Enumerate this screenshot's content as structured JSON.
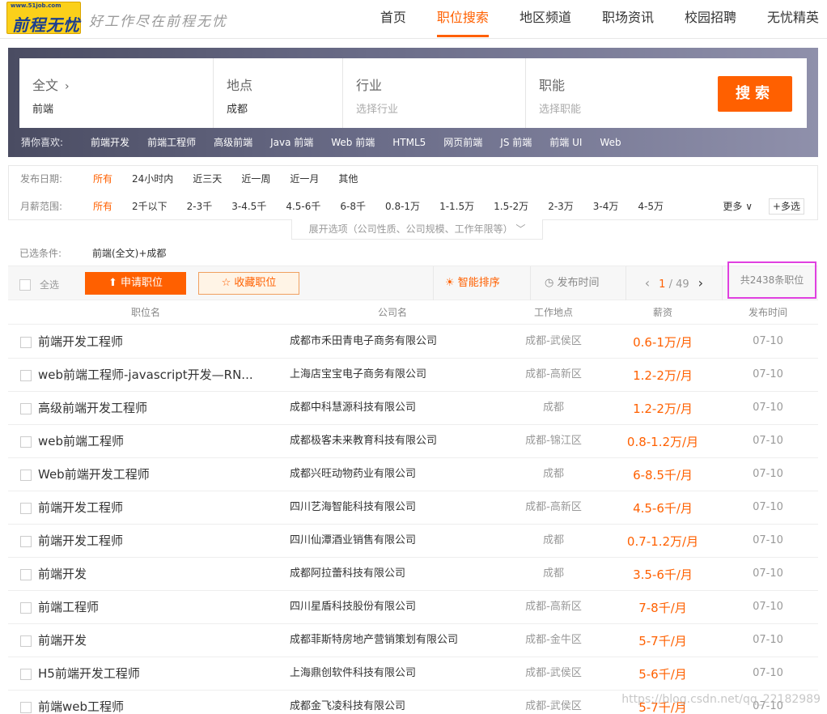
{
  "header": {
    "logo_url": "www.51job.com",
    "logo_text": "前程无忧",
    "slogan": "好工作尽在前程无忧",
    "nav": [
      "首页",
      "职位搜索",
      "地区频道",
      "职场资讯",
      "校园招聘",
      "无忧精英"
    ],
    "active_nav": "职位搜索"
  },
  "search": {
    "fulltext_label": "全文",
    "fulltext_value": "前端",
    "location_label": "地点",
    "location_value": "成都",
    "industry_label": "行业",
    "industry_placeholder": "选择行业",
    "function_label": "职能",
    "function_placeholder": "选择职能",
    "button": "搜索",
    "guess_label": "猜你喜欢:",
    "guess_items": [
      "前端开发",
      "前端工程师",
      "高级前端",
      "Java 前端",
      "Web 前端",
      "HTML5",
      "网页前端",
      "JS 前端",
      "前端 UI",
      "Web"
    ]
  },
  "filters": {
    "date_label": "发布日期:",
    "date_options": [
      "所有",
      "24小时内",
      "近三天",
      "近一周",
      "近一月",
      "其他"
    ],
    "salary_label": "月薪范围:",
    "salary_options": [
      "所有",
      "2千以下",
      "2-3千",
      "3-4.5千",
      "4.5-6千",
      "6-8千",
      "0.8-1万",
      "1-1.5万",
      "1.5-2万",
      "2-3万",
      "3-4万",
      "4-5万"
    ],
    "more": "更多",
    "multi": "多选",
    "expand": "展开选项（公司性质、公司规模、工作年限等）"
  },
  "selected": {
    "label": "已选条件:",
    "value": "前端(全文)+成都"
  },
  "toolbar": {
    "select_all": "全选",
    "apply": "申请职位",
    "collect": "收藏职位",
    "sort_smart": "智能排序",
    "sort_time": "发布时间",
    "page_current": "1",
    "page_total": "/ 49",
    "total": "共2438条职位"
  },
  "table": {
    "headers": [
      "职位名",
      "公司名",
      "工作地点",
      "薪资",
      "发布时间"
    ],
    "rows": [
      {
        "title": "前端开发工程师",
        "company": "成都市禾田青电子商务有限公司",
        "location": "成都-武侯区",
        "salary": "0.6-1万/月",
        "date": "07-10"
      },
      {
        "title": "web前端工程师-javascript开发—RN...",
        "company": "上海店宝宝电子商务有限公司",
        "location": "成都-高新区",
        "salary": "1.2-2万/月",
        "date": "07-10"
      },
      {
        "title": "高级前端开发工程师",
        "company": "成都中科慧源科技有限公司",
        "location": "成都",
        "salary": "1.2-2万/月",
        "date": "07-10"
      },
      {
        "title": "web前端工程师",
        "company": "成都极客未来教育科技有限公司",
        "location": "成都-锦江区",
        "salary": "0.8-1.2万/月",
        "date": "07-10"
      },
      {
        "title": "Web前端开发工程师",
        "company": "成都兴旺动物药业有限公司",
        "location": "成都",
        "salary": "6-8.5千/月",
        "date": "07-10"
      },
      {
        "title": "前端开发工程师",
        "company": "四川艺海智能科技有限公司",
        "location": "成都-高新区",
        "salary": "4.5-6千/月",
        "date": "07-10"
      },
      {
        "title": "前端开发工程师",
        "company": "四川仙潭酒业销售有限公司",
        "location": "成都",
        "salary": "0.7-1.2万/月",
        "date": "07-10"
      },
      {
        "title": "前端开发",
        "company": "成都阿拉蕾科技有限公司",
        "location": "成都",
        "salary": "3.5-6千/月",
        "date": "07-10"
      },
      {
        "title": "前端工程师",
        "company": "四川星盾科技股份有限公司",
        "location": "成都-高新区",
        "salary": "7-8千/月",
        "date": "07-10"
      },
      {
        "title": "前端开发",
        "company": "成都菲斯特房地产营销策划有限公司",
        "location": "成都-金牛区",
        "salary": "5-7千/月",
        "date": "07-10"
      },
      {
        "title": "H5前端开发工程师",
        "company": "上海鼎创软件科技有限公司",
        "location": "成都-武侯区",
        "salary": "5-6千/月",
        "date": "07-10"
      },
      {
        "title": "前端web工程师",
        "company": "成都金飞凌科技有限公司",
        "location": "成都-武侯区",
        "salary": "5-7千/月",
        "date": "07-10"
      }
    ]
  },
  "watermark": "https://blog.csdn.net/qq_22182989"
}
